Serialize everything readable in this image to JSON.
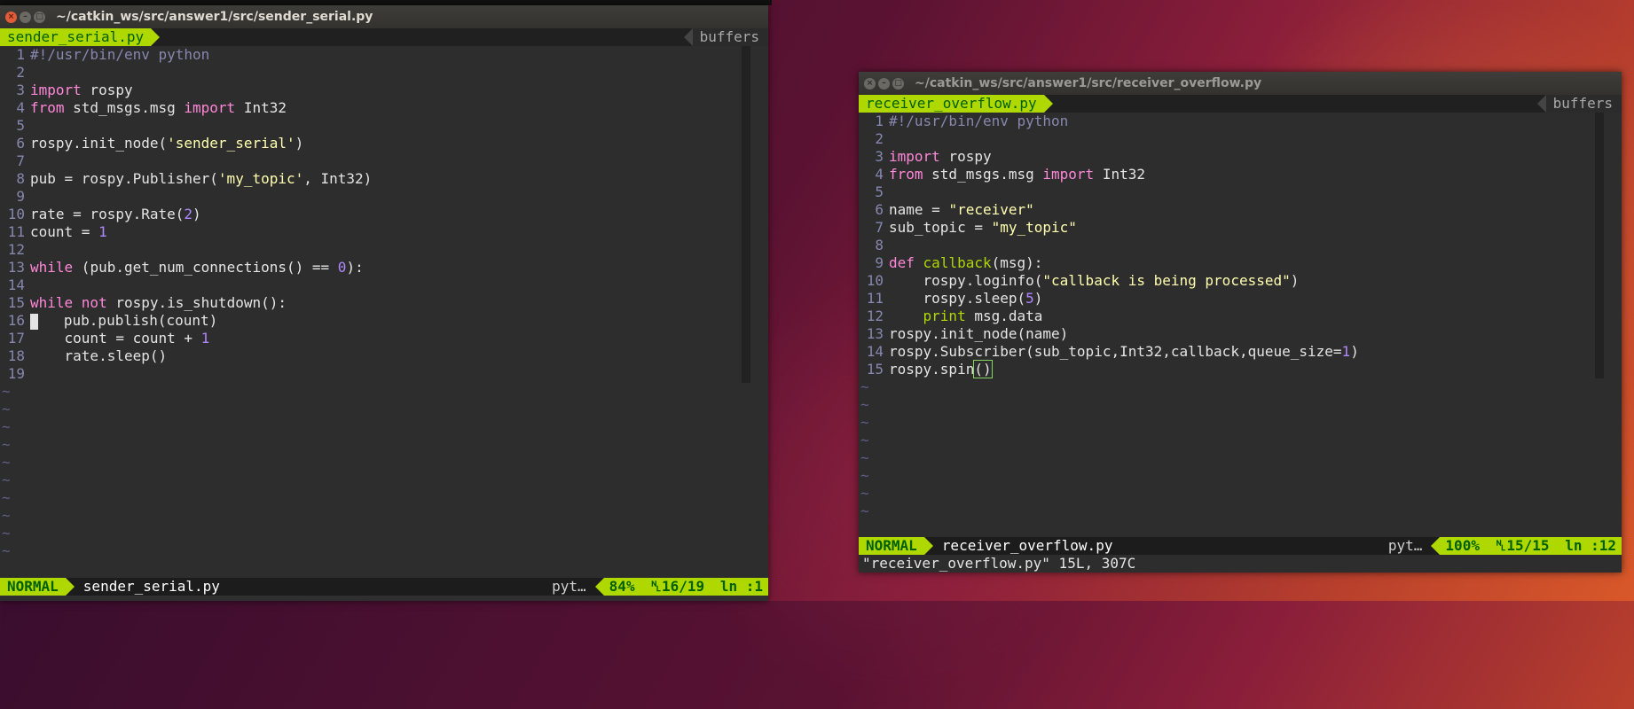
{
  "left_window": {
    "title": "~/catkin_ws/src/answer1/src/sender_serial.py",
    "tab_label": "sender_serial.py",
    "buffers_label": "buffers",
    "lines": [
      {
        "n": "1",
        "code": "#!/usr/bin/env python"
      },
      {
        "n": "2",
        "code": ""
      },
      {
        "n": "3",
        "code": "import rospy"
      },
      {
        "n": "4",
        "code": "from std_msgs.msg import Int32"
      },
      {
        "n": "5",
        "code": ""
      },
      {
        "n": "6",
        "code": "rospy.init_node('sender_serial')"
      },
      {
        "n": "7",
        "code": ""
      },
      {
        "n": "8",
        "code": "pub = rospy.Publisher('my_topic', Int32)"
      },
      {
        "n": "9",
        "code": ""
      },
      {
        "n": "10",
        "code": "rate = rospy.Rate(2)"
      },
      {
        "n": "11",
        "code": "count = 1"
      },
      {
        "n": "12",
        "code": ""
      },
      {
        "n": "13",
        "code": "while (pub.get_num_connections() == 0):"
      },
      {
        "n": "14",
        "code": ""
      },
      {
        "n": "15",
        "code": "while not rospy.is_shutdown():"
      },
      {
        "n": "16",
        "code": "    pub.publish(count)"
      },
      {
        "n": "17",
        "code": "    count = count + 1"
      },
      {
        "n": "18",
        "code": "    rate.sleep()"
      },
      {
        "n": "19",
        "code": ""
      }
    ],
    "status": {
      "mode": "NORMAL",
      "filename": "sender_serial.py",
      "filetype": "pyt…",
      "percent": "84%",
      "line_pos": "␤16/19",
      "col": "ln :1"
    }
  },
  "right_window": {
    "title": "~/catkin_ws/src/answer1/src/receiver_overflow.py",
    "tab_label": "receiver_overflow.py",
    "buffers_label": "buffers",
    "lines": [
      {
        "n": "1",
        "code": "#!/usr/bin/env python"
      },
      {
        "n": "2",
        "code": ""
      },
      {
        "n": "3",
        "code": "import rospy"
      },
      {
        "n": "4",
        "code": "from std_msgs.msg import Int32"
      },
      {
        "n": "5",
        "code": ""
      },
      {
        "n": "6",
        "code": "name = \"receiver\""
      },
      {
        "n": "7",
        "code": "sub_topic = \"my_topic\""
      },
      {
        "n": "8",
        "code": ""
      },
      {
        "n": "9",
        "code": "def callback(msg):"
      },
      {
        "n": "10",
        "code": "    rospy.loginfo(\"callback is being processed\")"
      },
      {
        "n": "11",
        "code": "    rospy.sleep(5)"
      },
      {
        "n": "12",
        "code": "    print msg.data"
      },
      {
        "n": "13",
        "code": "rospy.init_node(name)"
      },
      {
        "n": "14",
        "code": "rospy.Subscriber(sub_topic,Int32,callback,queue_size=1)"
      },
      {
        "n": "15",
        "code": "rospy.spin()"
      }
    ],
    "status": {
      "mode": "NORMAL",
      "filename": "receiver_overflow.py",
      "filetype": "pyt…",
      "percent": "100%",
      "line_pos": "␤15/15",
      "col": "ln :12"
    },
    "cmdline": "\"receiver_overflow.py\" 15L, 307C"
  },
  "colors": {
    "accent": "#afd700",
    "accent_text": "#005f00",
    "editor_bg": "#2d2d2d"
  }
}
